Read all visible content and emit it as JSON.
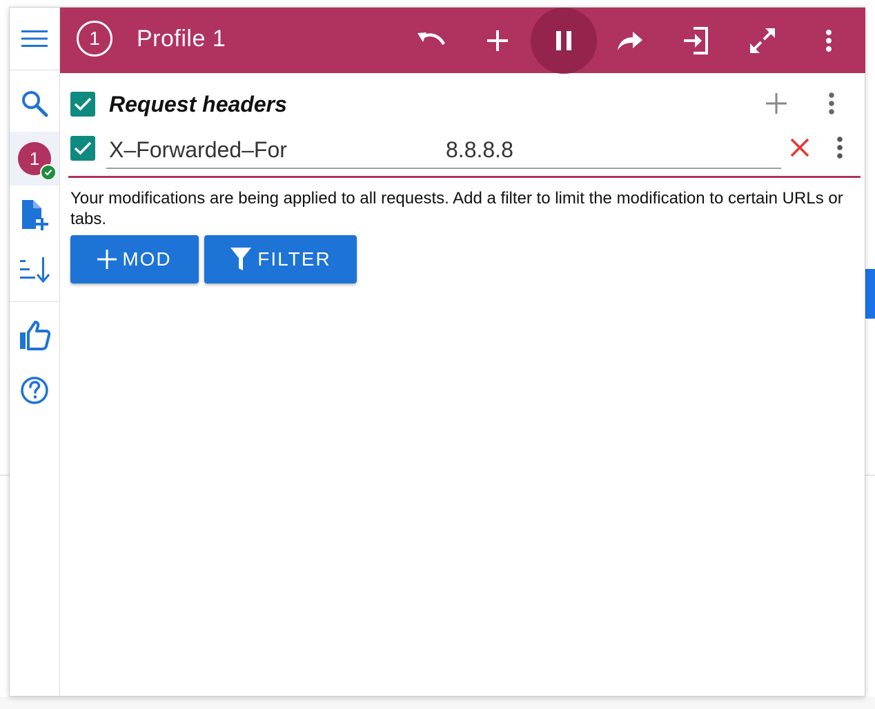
{
  "colors": {
    "header_bg": "#b0325f",
    "accent_blue": "#1e73d6",
    "checkbox": "#0f8a80",
    "delete_red": "#e53935"
  },
  "sidebar": {
    "items": [
      {
        "name": "menu",
        "icon": "menu-icon"
      },
      {
        "name": "search",
        "icon": "search-icon"
      },
      {
        "name": "profile-1",
        "label": "1",
        "icon": "check-circle-icon"
      },
      {
        "name": "add-profile",
        "icon": "file-add-icon"
      },
      {
        "name": "sort",
        "icon": "sort-icon"
      },
      {
        "name": "rate",
        "icon": "thumbs-up-icon"
      },
      {
        "name": "help",
        "icon": "help-circle-icon"
      }
    ]
  },
  "header": {
    "profile_number": "1",
    "title": "Profile 1",
    "actions": [
      {
        "name": "undo",
        "icon": "undo-icon"
      },
      {
        "name": "add",
        "icon": "plus-icon"
      },
      {
        "name": "pause",
        "icon": "pause-icon"
      },
      {
        "name": "share",
        "icon": "share-icon"
      },
      {
        "name": "import",
        "icon": "login-icon"
      },
      {
        "name": "expand",
        "icon": "expand-icon"
      },
      {
        "name": "more",
        "icon": "more-vert-icon"
      }
    ]
  },
  "section": {
    "title": "Request headers",
    "enabled": true
  },
  "headers": [
    {
      "name": "X–Forwarded–For",
      "value": "8.8.8.8",
      "enabled": true
    }
  ],
  "info_text": "Your modifications are being applied to all requests. Add a filter to limit the modification to certain URLs or tabs.",
  "buttons": {
    "mod_label": "MOD",
    "filter_label": "FILTER"
  }
}
